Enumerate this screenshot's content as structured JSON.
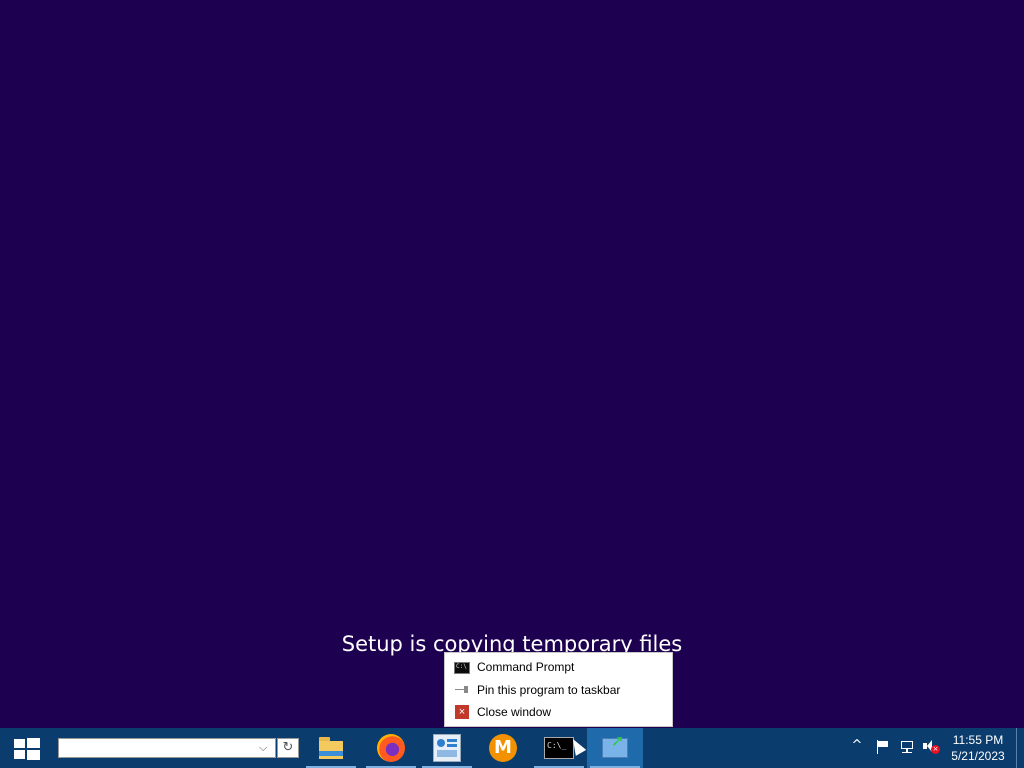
{
  "background_color": "#1e0050",
  "setup": {
    "status_text": "Setup is copying temporary files"
  },
  "jumplist": {
    "items": [
      {
        "label": "Command Prompt",
        "icon": "command-prompt-icon"
      },
      {
        "label": "Pin this program to taskbar",
        "icon": "pin-icon"
      },
      {
        "label": "Close window",
        "icon": "close-icon"
      }
    ]
  },
  "taskbar": {
    "color": "#0a3d6e",
    "search": {
      "value": "",
      "placeholder": "",
      "dropdown_glyph": "⌵",
      "refresh_glyph": "↻"
    },
    "apps": [
      {
        "name": "file-explorer",
        "icon": "folder-icon"
      },
      {
        "name": "firefox",
        "icon": "firefox-icon"
      },
      {
        "name": "control-panel",
        "icon": "control-panel-icon"
      },
      {
        "name": "m-app",
        "icon": "m-icon",
        "glyph": "M"
      },
      {
        "name": "command-prompt",
        "icon": "command-prompt-icon",
        "glyph": "C:\\_"
      },
      {
        "name": "setup",
        "icon": "setup-icon",
        "glyph": "➚"
      }
    ],
    "tray": {
      "overflow_glyph": "^",
      "volume_muted_glyph": "×"
    },
    "clock": {
      "time": "11:55 PM",
      "date": "5/21/2023"
    }
  }
}
